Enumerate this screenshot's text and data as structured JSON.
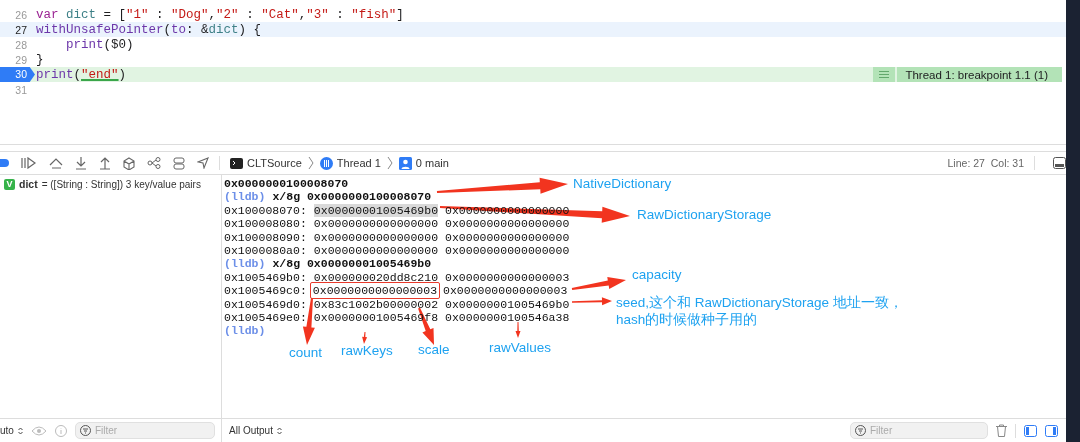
{
  "editor": {
    "lines": [
      {
        "number": "26",
        "current": false,
        "breakpoint": false,
        "tokens": [
          {
            "kind": "keyword",
            "text": "var"
          },
          {
            "kind": "ident",
            "text": " dict"
          },
          {
            "kind": "plain",
            "text": " = ["
          },
          {
            "kind": "string",
            "text": "\"1\""
          },
          {
            "kind": "plain",
            "text": " : "
          },
          {
            "kind": "string",
            "text": "\"Dog\""
          },
          {
            "kind": "plain",
            "text": ","
          },
          {
            "kind": "string",
            "text": "\"2\""
          },
          {
            "kind": "plain",
            "text": " : "
          },
          {
            "kind": "string",
            "text": "\"Cat\""
          },
          {
            "kind": "plain",
            "text": ","
          },
          {
            "kind": "string",
            "text": "\"3\""
          },
          {
            "kind": "plain",
            "text": " : "
          },
          {
            "kind": "string",
            "text": "\"fish\""
          },
          {
            "kind": "plain",
            "text": "]"
          }
        ]
      },
      {
        "number": "27",
        "current": true,
        "breakpoint": false,
        "tokens": [
          {
            "kind": "func",
            "text": "withUnsafePointer"
          },
          {
            "kind": "plain",
            "text": "("
          },
          {
            "kind": "func",
            "text": "to"
          },
          {
            "kind": "plain",
            "text": ": &"
          },
          {
            "kind": "ident",
            "text": "dict"
          },
          {
            "kind": "plain",
            "text": ") {"
          }
        ]
      },
      {
        "number": "28",
        "current": false,
        "breakpoint": false,
        "indented": true,
        "tokens": [
          {
            "kind": "func",
            "text": "print"
          },
          {
            "kind": "plain",
            "text": "($0)"
          }
        ]
      },
      {
        "number": "29",
        "current": false,
        "breakpoint": false,
        "tokens": [
          {
            "kind": "plain",
            "text": "}"
          }
        ]
      },
      {
        "number": "30",
        "current": false,
        "breakpoint": true,
        "annotation": "Thread 1: breakpoint 1.1 (1)",
        "tokens": [
          {
            "kind": "func",
            "text": "print"
          },
          {
            "kind": "plain",
            "text": "("
          },
          {
            "kind": "string",
            "text": "\"end\"",
            "marked": true
          },
          {
            "kind": "plain",
            "text": ")"
          }
        ]
      },
      {
        "number": "31",
        "current": false,
        "breakpoint": false
      }
    ]
  },
  "debug_bar": {
    "breadcrumbs": [
      {
        "kind": "app",
        "label": "CLTSource"
      },
      {
        "kind": "thread",
        "label": "Thread 1"
      },
      {
        "kind": "frame",
        "label": "0 main"
      }
    ],
    "cursor": "Line: 27  Col: 31"
  },
  "variables": [
    {
      "badge": "V",
      "name": "dict",
      "value": "= ([String : String]) 3 key/value pairs"
    }
  ],
  "console": [
    {
      "kind": "output",
      "text": "0x0000000100008070"
    },
    {
      "kind": "command",
      "prompt": "(lldb)",
      "text": "x/8g 0x0000000100008070"
    },
    {
      "kind": "memory",
      "address": "0x100008070:",
      "values": [
        {
          "text": "0x00000001005469b0",
          "selected": true
        },
        {
          "text": "0x0000000000000000",
          "selected": false
        }
      ]
    },
    {
      "kind": "memory",
      "address": "0x100008080:",
      "values": [
        {
          "text": "0x0000000000000000",
          "selected": false
        },
        {
          "text": "0x0000000000000000",
          "selected": false
        }
      ]
    },
    {
      "kind": "memory",
      "address": "0x100008090:",
      "values": [
        {
          "text": "0x0000000000000000",
          "selected": false
        },
        {
          "text": "0x0000000000000000",
          "selected": false
        }
      ]
    },
    {
      "kind": "memory",
      "address": "0x1000080a0:",
      "values": [
        {
          "text": "0x0000000000000000",
          "selected": false
        },
        {
          "text": "0x0000000000000000",
          "selected": false
        }
      ]
    },
    {
      "kind": "command",
      "prompt": "(lldb)",
      "text": "x/8g 0x00000001005469b0"
    },
    {
      "kind": "memory",
      "address": "0x1005469b0:",
      "values": [
        {
          "text": "0x000000020dd8c210",
          "selected": false
        },
        {
          "text": "0x0000000000000003",
          "selected": false
        }
      ]
    },
    {
      "kind": "memory",
      "address": "0x1005469c0:",
      "values": [
        {
          "text": "0x0000000000000003",
          "selected": false,
          "framed": true
        },
        {
          "text": "0x0000000000000003",
          "selected": false
        }
      ]
    },
    {
      "kind": "memory",
      "address": "0x1005469d0:",
      "values": [
        {
          "text": "0x83c1002b00000002",
          "selected": false
        },
        {
          "text": "0x00000001005469b0",
          "selected": false
        }
      ]
    },
    {
      "kind": "memory",
      "address": "0x1005469e0:",
      "values": [
        {
          "text": "0x00000001005469f8",
          "selected": false
        },
        {
          "text": "0x0000000100546a38",
          "selected": false
        }
      ]
    },
    {
      "kind": "command",
      "prompt": "(lldb)"
    }
  ],
  "annotations": [
    {
      "lines": [
        "NativeDictionary"
      ]
    },
    {
      "lines": [
        "RawDictionaryStorage"
      ]
    },
    {
      "lines": [
        "capacity"
      ]
    },
    {
      "lines": [
        "seed,这个和 RawDictionaryStorage 地址一致，",
        "hash的时候做种子用的"
      ]
    },
    {
      "lines": [
        "count"
      ]
    },
    {
      "lines": [
        "rawKeys"
      ]
    },
    {
      "lines": [
        "scale"
      ]
    },
    {
      "lines": [
        "rawValues"
      ]
    }
  ],
  "bottom_bar": {
    "scope": "uto",
    "left_filter": {
      "placeholder": "Filter"
    },
    "output": "All Output",
    "right_filter": {
      "placeholder": "Filter"
    }
  }
}
